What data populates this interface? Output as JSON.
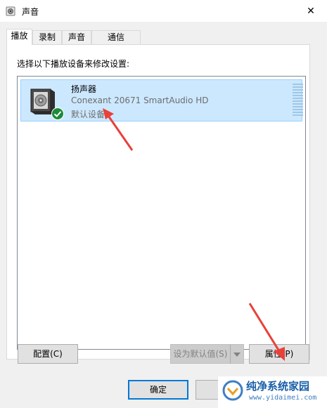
{
  "window": {
    "title": "声音",
    "icon": "speaker-icon",
    "close_glyph": "✕"
  },
  "tabs": [
    {
      "label": "播放",
      "active": true
    },
    {
      "label": "录制",
      "active": false
    },
    {
      "label": "声音",
      "active": false
    },
    {
      "label": "通信",
      "active": false
    }
  ],
  "playback": {
    "instruction": "选择以下播放设备来修改设置:",
    "devices": [
      {
        "name": "扬声器",
        "description": "Conexant 20671 SmartAudio HD",
        "status": "默认设备",
        "icon": "speaker-device-icon",
        "badge": "check-icon",
        "selected": true
      }
    ]
  },
  "buttons": {
    "configure": "配置(C)",
    "set_default": "设为默认值(S)",
    "properties": "属性(P)",
    "ok": "确定",
    "cancel": "取"
  },
  "watermark": {
    "title": "纯净系统家园",
    "url": "www.yidaimei.com"
  },
  "colors": {
    "selection_bg": "#cce8ff",
    "selection_border": "#99d1ff",
    "primary_border": "#0078d7",
    "annotation_arrow": "#e8413a"
  }
}
